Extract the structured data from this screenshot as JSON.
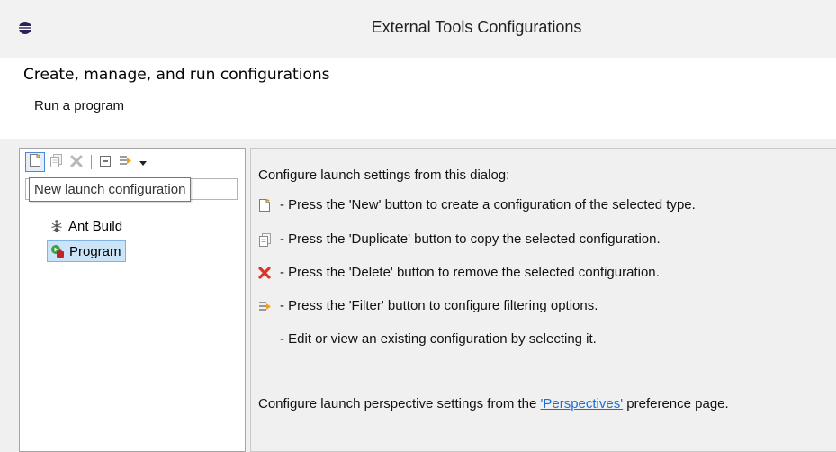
{
  "window": {
    "title": "External Tools Configurations"
  },
  "header": {
    "title": "Create, manage, and run configurations",
    "subtitle": "Run a program"
  },
  "tooltip": {
    "text": "New launch configuration"
  },
  "tree": {
    "items": [
      {
        "label": "Ant Build",
        "icon": "ant-icon",
        "selected": false
      },
      {
        "label": "Program",
        "icon": "program-icon",
        "selected": true
      }
    ]
  },
  "help": {
    "intro": "Configure launch settings from this dialog:",
    "new_line": "- Press the 'New' button to create a configuration of the selected type.",
    "duplicate_line": "- Press the 'Duplicate' button to copy the selected configuration.",
    "delete_line": "- Press the 'Delete' button to remove the selected configuration.",
    "filter_line": "- Press the 'Filter' button to configure filtering options.",
    "edit_line": "- Edit or view an existing configuration by selecting it.",
    "perspective_prefix": "Configure launch perspective settings from the ",
    "perspective_link": "'Perspectives'",
    "perspective_suffix": " preference page."
  },
  "colors": {
    "selection": "#cce4f7",
    "link": "#1a6ed6",
    "delete_red": "#d9342b"
  }
}
